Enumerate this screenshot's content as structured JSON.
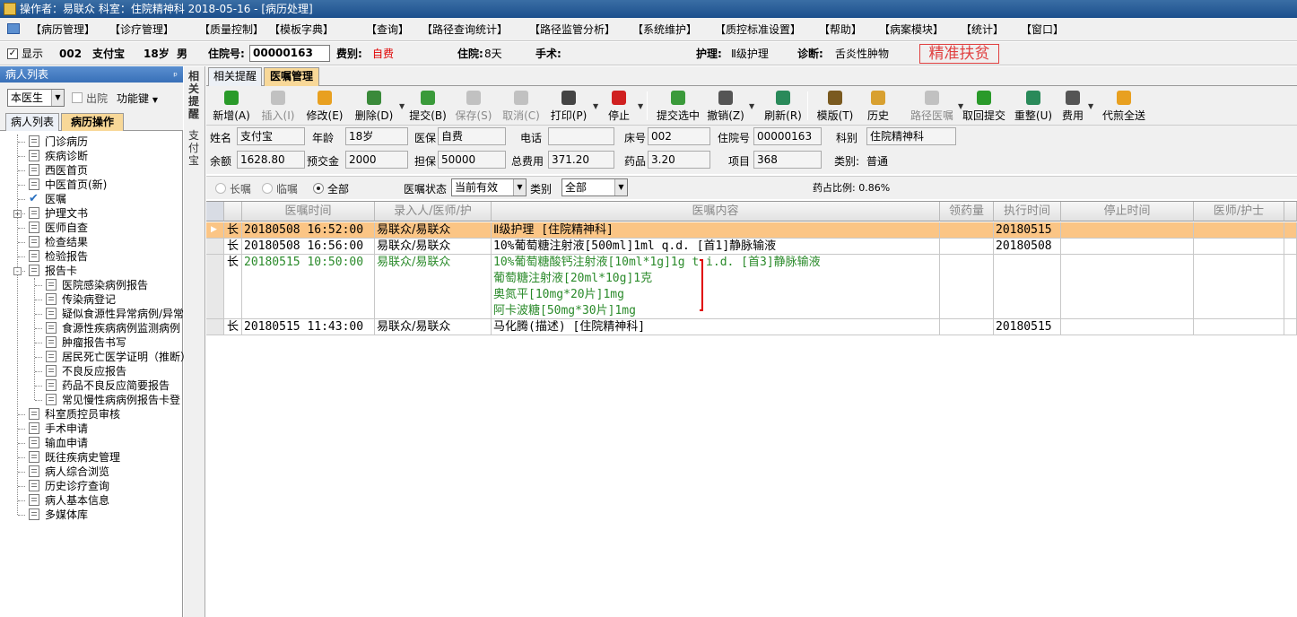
{
  "window": {
    "title": "操作者：易联众  科室：住院精神科  2018-05-16 - [病历处理]"
  },
  "menu": [
    "【病历管理】",
    "【诊疗管理】",
    "【质量控制】",
    "【模板字典】",
    "【查询】",
    "【路径查询统计】",
    "【路径监管分析】",
    "【系统维护】",
    "【质控标准设置】",
    "【帮助】",
    "【病案模块】",
    "【统计】",
    "【窗口】"
  ],
  "patient_bar": {
    "show_label": "显示",
    "bed": "002",
    "name": "支付宝",
    "age": "18岁",
    "sex": "男",
    "inpatient_no_label": "住院号:",
    "inpatient_no": "00000163",
    "fee_type_label": "费别:",
    "fee_type": "自费",
    "stay_label": "住院:",
    "stay": "8天",
    "surgery_label": "手术:",
    "nursing_label": "护理:",
    "nursing": "Ⅱ级护理",
    "diagnosis_label": "诊断:",
    "diagnosis": "舌炎性肿物",
    "poverty_badge": "精准扶贫"
  },
  "left_pane": {
    "title": "病人列表",
    "pin": "ᵖ",
    "doctor_filter": "本医生",
    "discharged_label": "出院",
    "func_button": "功能键",
    "tabs": [
      "病人列表",
      "病历操作"
    ],
    "tree": [
      {
        "label": "门诊病历",
        "level": 0
      },
      {
        "label": "疾病诊断",
        "level": 0
      },
      {
        "label": "西医首页",
        "level": 0
      },
      {
        "label": "中医首页(新)",
        "level": 0
      },
      {
        "label": "医嘱",
        "level": 0
      },
      {
        "label": "护理文书",
        "level": 0,
        "expand": "+"
      },
      {
        "label": "医师自查",
        "level": 0
      },
      {
        "label": "检查结果",
        "level": 0
      },
      {
        "label": "检验报告",
        "level": 0
      },
      {
        "label": "报告卡",
        "level": 0,
        "expand": "-"
      },
      {
        "label": "医院感染病例报告",
        "level": 1
      },
      {
        "label": "传染病登记",
        "level": 1
      },
      {
        "label": "疑似食源性异常病例/异常",
        "level": 1
      },
      {
        "label": "食源性疾病病例监测病例",
        "level": 1
      },
      {
        "label": "肿瘤报告书写",
        "level": 1
      },
      {
        "label": "居民死亡医学证明（推断）",
        "level": 1
      },
      {
        "label": "不良反应报告",
        "level": 1
      },
      {
        "label": "药品不良反应简要报告",
        "level": 1
      },
      {
        "label": "常见慢性病病例报告卡登",
        "level": 1
      },
      {
        "label": "科室质控员审核",
        "level": 0
      },
      {
        "label": "手术申请",
        "level": 0
      },
      {
        "label": "输血申请",
        "level": 0
      },
      {
        "label": "既往疾病史管理",
        "level": 0
      },
      {
        "label": "病人综合浏览",
        "level": 0
      },
      {
        "label": "历史诊疗查询",
        "level": 0
      },
      {
        "label": "病人基本信息",
        "level": 0
      },
      {
        "label": "多媒体库",
        "level": 0
      }
    ]
  },
  "vstrip": {
    "top": "相关提醒",
    "bottom": "支付宝"
  },
  "right_tabs": [
    "相关提醒",
    "医嘱管理"
  ],
  "toolbar": [
    {
      "label": "新增(A)",
      "icon": "add-icon",
      "color": "#2a9a2a"
    },
    {
      "label": "插入(I)",
      "icon": "insert-icon",
      "color": "#888",
      "disabled": true
    },
    {
      "label": "修改(E)",
      "icon": "edit-icon",
      "color": "#e8a020"
    },
    {
      "label": "删除(D)",
      "icon": "delete-icon",
      "color": "#3a8a3a",
      "dropdown": true
    },
    {
      "label": "提交(B)",
      "icon": "submit-icon",
      "color": "#3a9a3a"
    },
    {
      "label": "保存(S)",
      "icon": "save-icon",
      "color": "#888",
      "disabled": true
    },
    {
      "label": "取消(C)",
      "icon": "cancel-icon",
      "color": "#888",
      "disabled": true
    },
    {
      "label": "打印(P)",
      "icon": "print-icon",
      "color": "#444",
      "dropdown": true
    },
    {
      "label": "停止",
      "icon": "stop-icon",
      "color": "#d02020",
      "dropdown": true
    },
    {
      "label": "提交选中",
      "icon": "submit-selected-icon",
      "color": "#3a9a3a"
    },
    {
      "label": "撤销(Z)",
      "icon": "trash-icon",
      "color": "#555",
      "dropdown": true
    },
    {
      "label": "刷新(R)",
      "icon": "refresh-icon",
      "color": "#2a8a5a"
    },
    {
      "label": "模版(T)",
      "icon": "template-icon",
      "color": "#7a5a20"
    },
    {
      "label": "历史",
      "icon": "history-icon",
      "color": "#d8a030"
    },
    {
      "label": "路径医嘱",
      "icon": "pathway-icon",
      "color": "#888",
      "disabled": true,
      "dropdown": true
    },
    {
      "label": "取回提交",
      "icon": "retrieve-icon",
      "color": "#2a9a2a"
    },
    {
      "label": "重整(U)",
      "icon": "reorganize-icon",
      "color": "#2a8a5a"
    },
    {
      "label": "费用",
      "icon": "fee-icon",
      "color": "#555",
      "dropdown": true
    },
    {
      "label": "代煎全送",
      "icon": "decoct-icon",
      "color": "#e8a020"
    }
  ],
  "info": {
    "name_label": "姓名",
    "name": "支付宝",
    "age_label": "年龄",
    "age": "18岁",
    "insurance_label": "医保",
    "insurance": "自费",
    "phone_label": "电话",
    "phone": "",
    "bed_label": "床号",
    "bed": "002",
    "inpatient_label": "住院号",
    "inpatient": "00000163",
    "dept_label": "科别",
    "dept": "住院精神科",
    "balance_label": "余额",
    "balance": "1628.80",
    "prepay_label": "预交金",
    "prepay": "2000",
    "guarantee_label": "担保",
    "guarantee": "50000",
    "total_label": "总费用",
    "total": "371.20",
    "drug_label": "药品",
    "drug": "3.20",
    "item_label": "项目",
    "item": "368",
    "category_label": "类别:",
    "category": "普通"
  },
  "filter": {
    "long_label": "长嘱",
    "temp_label": "临嘱",
    "all_label": "全部",
    "status_label": "医嘱状态",
    "status": "当前有效",
    "type_label": "类别",
    "type": "全部",
    "drug_ratio": "药占比例: 0.86%"
  },
  "grid": {
    "headers": [
      "医嘱时间",
      "录入人/医师/护",
      "医嘱内容",
      "领药量",
      "执行时间",
      "停止时间",
      "医师/护士"
    ],
    "rows": [
      {
        "type": "长",
        "time": "20180508 16:52:00",
        "entry": "易联众/易联众",
        "content": [
          "Ⅱ级护理    [住院精神科]"
        ],
        "exec": "20180515",
        "highlight": true
      },
      {
        "type": "长",
        "time": "20180508 16:56:00",
        "entry": "易联众/易联众",
        "content": [
          "10%葡萄糖注射液[500ml]1ml q.d. [首1]静脉输液"
        ],
        "exec": "20180508"
      },
      {
        "type": "长",
        "time": "20180515 10:50:00",
        "entry": "易联众/易联众",
        "content": [
          "10%葡萄糖酸钙注射液[10ml*1g]1g t.i.d. [首3]静脉输液",
          "葡萄糖注射液[20ml*10g]1克",
          "奥氮平[10mg*20片]1mg",
          "阿卡波糖[50mg*30片]1mg"
        ],
        "exec": "",
        "green": true
      },
      {
        "type": "长",
        "time": "20180515 11:43:00",
        "entry": "易联众/易联众",
        "content": [
          "马化腾(描述)   [住院精神科]"
        ],
        "exec": "20180515"
      }
    ]
  },
  "colors": {
    "highlight_row": "#fbc585",
    "selected_tab": "#f8d898",
    "green_text": "#2a8a2a",
    "bracket": "#e00000"
  }
}
